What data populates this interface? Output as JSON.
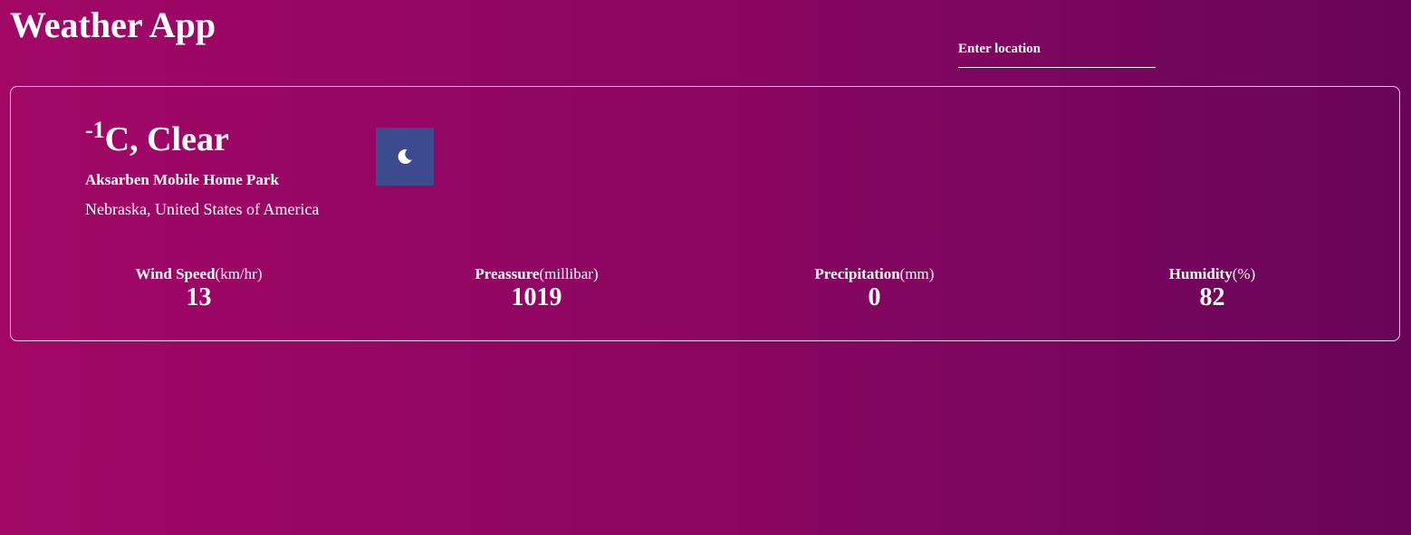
{
  "app": {
    "title": "Weather App"
  },
  "search": {
    "placeholder": "Enter location"
  },
  "current": {
    "temp_value": "-1",
    "temp_unit_condition": "C, Clear",
    "place": "Aksarben Mobile Home Park",
    "region": "Nebraska, United States of America",
    "icon": "moon-icon",
    "icon_bg": "#3c4a8e"
  },
  "stats": [
    {
      "label": "Wind Speed",
      "unit": "(km/hr)",
      "value": "13"
    },
    {
      "label": "Preassure",
      "unit": "(millibar)",
      "value": "1019"
    },
    {
      "label": "Precipitation",
      "unit": "(mm)",
      "value": "0"
    },
    {
      "label": "Humidity",
      "unit": "(%)",
      "value": "82"
    }
  ],
  "colors": {
    "gradient_start": "#a20766",
    "gradient_end": "#680559",
    "text": "#ffffff"
  }
}
